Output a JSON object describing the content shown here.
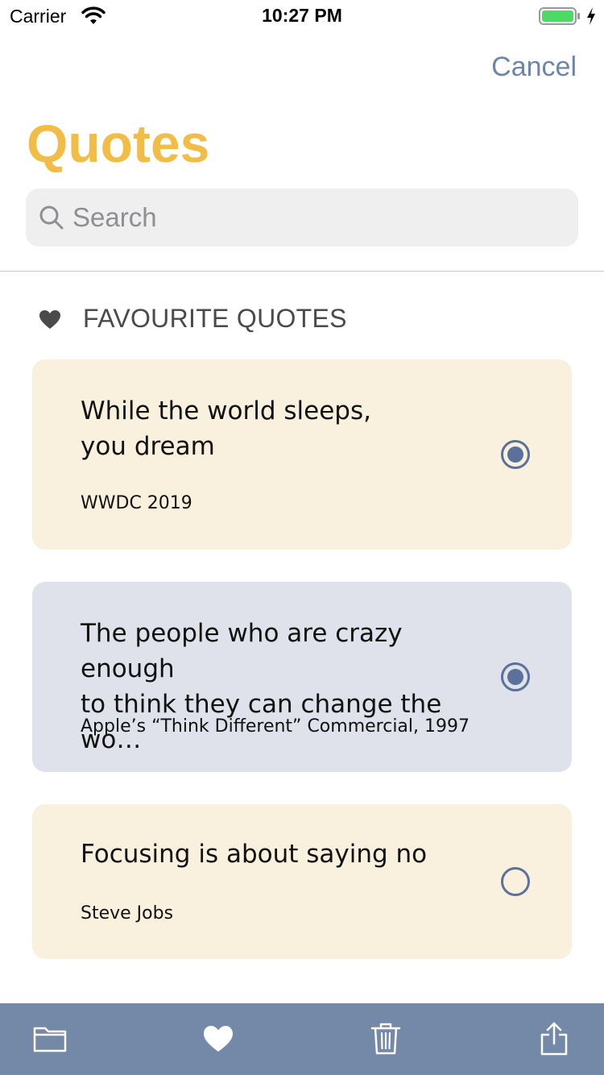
{
  "status_bar": {
    "carrier": "Carrier",
    "time": "10:27 PM",
    "battery_color": "#4cd964"
  },
  "nav": {
    "cancel_label": "Cancel"
  },
  "page": {
    "title": "Quotes",
    "title_color": "#f2bd47"
  },
  "search": {
    "placeholder": "Search",
    "value": ""
  },
  "section": {
    "icon": "heart-icon",
    "title": "FAVOURITE QUOTES"
  },
  "quotes": [
    {
      "text": "While the world sleeps,\nyou dream",
      "source": "WWDC 2019",
      "selected": true,
      "background": "#f9f0dd"
    },
    {
      "text": "The people who are crazy enough\nto think they can change the wo…",
      "source": "Apple’s “Think Different” Commercial, 1997",
      "selected": true,
      "background": "#dfe2ea"
    },
    {
      "text": "Focusing is about saying no",
      "source": "Steve Jobs",
      "selected": false,
      "background": "#f9f0dd"
    }
  ],
  "toolbar": {
    "background": "#7489a7",
    "items": [
      "folder-icon",
      "heart-icon",
      "trash-icon",
      "share-icon"
    ]
  }
}
